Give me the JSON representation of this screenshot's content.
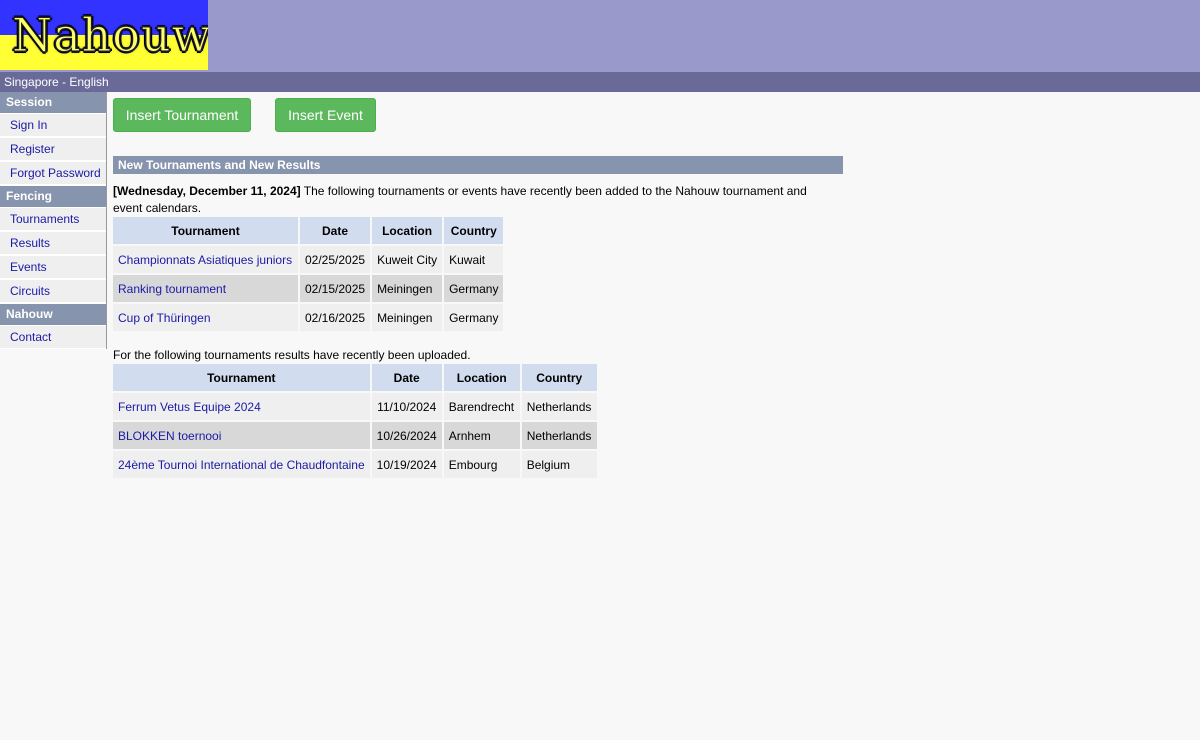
{
  "header": {
    "logo_text": "Nahouw"
  },
  "locale": "Singapore - English",
  "sidebar": {
    "sections": [
      {
        "title": "Session",
        "items": [
          "Sign In",
          "Register",
          "Forgot Password"
        ]
      },
      {
        "title": "Fencing",
        "items": [
          "Tournaments",
          "Results",
          "Events",
          "Circuits"
        ]
      },
      {
        "title": "Nahouw",
        "items": [
          "Contact"
        ]
      }
    ]
  },
  "buttons": {
    "insert_tournament": "Insert Tournament",
    "insert_event": "Insert Event"
  },
  "section_title": "New Tournaments and New Results",
  "intro": {
    "date": "[Wednesday, December 11, 2024]",
    "text": " The following tournaments or events have recently been added to the Nahouw tournament and event calendars."
  },
  "new_tournaments": {
    "headers": [
      "Tournament",
      "Date",
      "Location",
      "Country"
    ],
    "rows": [
      [
        "Championnats Asiatiques juniors",
        "02/25/2025",
        "Kuweit City",
        "Kuwait"
      ],
      [
        "Ranking tournament",
        "02/15/2025",
        "Meiningen",
        "Germany"
      ],
      [
        "Cup of Thüringen",
        "02/16/2025",
        "Meiningen",
        "Germany"
      ]
    ]
  },
  "results_intro": "For the following tournaments results have recently been uploaded.",
  "new_results": {
    "headers": [
      "Tournament",
      "Date",
      "Location",
      "Country"
    ],
    "rows": [
      [
        "Ferrum Vetus Equipe 2024",
        "11/10/2024",
        "Barendrecht",
        "Netherlands"
      ],
      [
        "BLOKKEN toernooi",
        "10/26/2024",
        "Arnhem",
        "Netherlands"
      ],
      [
        "24ème Tournoi International de Chaudfontaine",
        "10/19/2024",
        "Embourg",
        "Belgium"
      ]
    ]
  }
}
